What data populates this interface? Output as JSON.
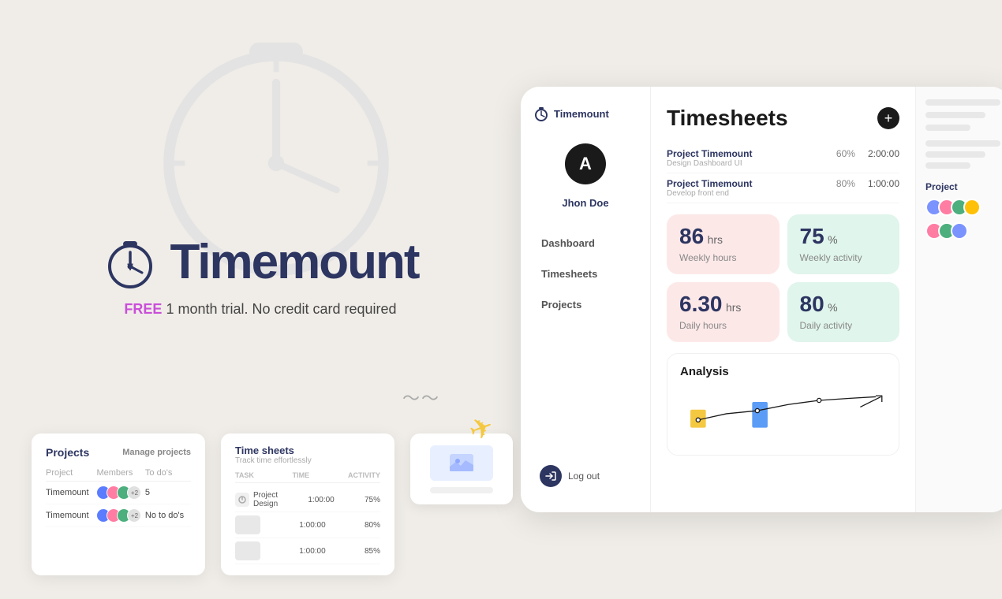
{
  "brand": {
    "name": "Timemount",
    "tagline_free": "FREE",
    "tagline_rest": " 1 month trial. No credit card required"
  },
  "sidebar": {
    "logo": "Timemount",
    "user": {
      "avatar_letter": "A",
      "name": "Jhon Doe"
    },
    "nav": [
      {
        "label": "Dashboard"
      },
      {
        "label": "Timesheets"
      },
      {
        "label": "Projects"
      }
    ],
    "logout_label": "Log out"
  },
  "main": {
    "title": "Timesheets",
    "add_btn": "+",
    "entries": [
      {
        "project": "Project Timemount",
        "task": "Design Dashboard UI",
        "percent": "60%",
        "time": "2:00:00"
      },
      {
        "project": "Project Timemount",
        "task": "Develop front end",
        "percent": "80%",
        "time": "1:00:00"
      }
    ],
    "stats": [
      {
        "value": "86",
        "unit": "hrs",
        "label": "Weekly hours",
        "color": "pink"
      },
      {
        "value": "75",
        "unit": "%",
        "label": "Weekly activity",
        "color": "green"
      },
      {
        "value": "6.30",
        "unit": "hrs",
        "label": "Daily hours",
        "color": "pink"
      },
      {
        "value": "80",
        "unit": "%",
        "label": "Daily activity",
        "color": "green"
      }
    ],
    "analysis_title": "Analysis"
  },
  "mini_projects": {
    "title": "Projects",
    "manage": "Manage projects",
    "headers": [
      "Project",
      "Members",
      "To do's"
    ],
    "rows": [
      {
        "name": "Timemount",
        "todos": "5"
      },
      {
        "name": "Timemount",
        "todos": "No to do's"
      }
    ]
  },
  "mini_timesheet": {
    "title": "Time sheets",
    "subtitle": "Track time effortlessly",
    "headers": [
      "TASK",
      "TIME",
      "ACTIVITY"
    ],
    "rows": [
      {
        "task": "Project Design",
        "time": "1:00:00",
        "activity": "75%"
      },
      {
        "task": "",
        "time": "1:00:00",
        "activity": "80%"
      },
      {
        "task": "",
        "time": "1:00:00",
        "activity": "85%"
      }
    ]
  },
  "colors": {
    "brand_dark": "#2d3561",
    "accent_pink": "#c94fd8",
    "stat_pink_bg": "#fde8e8",
    "stat_green_bg": "#e0f5ec",
    "bg": "#f0ede8"
  }
}
